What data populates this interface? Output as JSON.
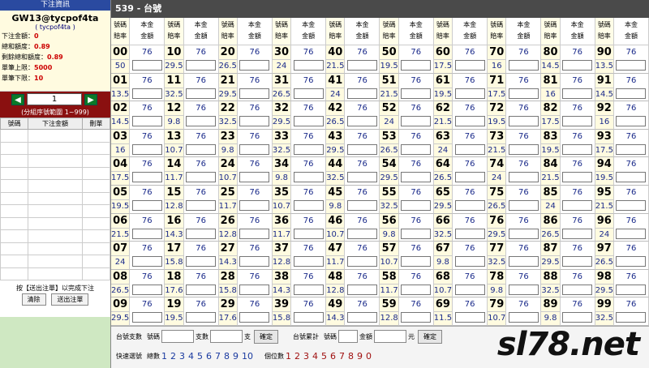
{
  "sidebar": {
    "header": "下注資訊",
    "account": "GW13@tycpof4ta",
    "account_sub": "( tycpof4ta )",
    "rows": [
      {
        "label": "下注金額：",
        "value": "0"
      },
      {
        "label": "總和額度：",
        "value": "0.89"
      },
      {
        "label": "剩餘總和額度：",
        "value": "0.89"
      },
      {
        "label": "單筆上限：",
        "value": "5000"
      },
      {
        "label": "單筆下限：",
        "value": "10"
      }
    ],
    "page_value": "1",
    "range_text": "(分組序號範圍 1~999)",
    "columns": [
      "號碼",
      "下注金額",
      "刪單"
    ],
    "note": "按【送出注單】以完成下注",
    "clear_label": "清除",
    "submit_label": "送出注單"
  },
  "main": {
    "title": "539 - 台號",
    "header_top": [
      "號碼",
      "本金"
    ],
    "header_bottom": [
      "賠率",
      "金額"
    ],
    "odds_value": "76",
    "cells": [
      [
        [
          "00",
          "50"
        ],
        [
          "10",
          "29.5"
        ],
        [
          "20",
          "26.5"
        ],
        [
          "30",
          "24"
        ],
        [
          "40",
          "21.5"
        ],
        [
          "50",
          "19.5"
        ],
        [
          "60",
          "17.5"
        ],
        [
          "70",
          "16"
        ],
        [
          "80",
          "14.5"
        ],
        [
          "90",
          "13.5"
        ]
      ],
      [
        [
          "01",
          "13.5"
        ],
        [
          "11",
          "32.5"
        ],
        [
          "21",
          "29.5"
        ],
        [
          "31",
          "26.5"
        ],
        [
          "41",
          "24"
        ],
        [
          "51",
          "21.5"
        ],
        [
          "61",
          "19.5"
        ],
        [
          "71",
          "17.5"
        ],
        [
          "81",
          "16"
        ],
        [
          "91",
          "14.5"
        ]
      ],
      [
        [
          "02",
          "14.5"
        ],
        [
          "12",
          "9.8"
        ],
        [
          "22",
          "32.5"
        ],
        [
          "32",
          "29.5"
        ],
        [
          "42",
          "26.5"
        ],
        [
          "52",
          "24"
        ],
        [
          "62",
          "21.5"
        ],
        [
          "72",
          "19.5"
        ],
        [
          "82",
          "17.5"
        ],
        [
          "92",
          "16"
        ]
      ],
      [
        [
          "03",
          "16"
        ],
        [
          "13",
          "10.7"
        ],
        [
          "23",
          "9.8"
        ],
        [
          "33",
          "32.5"
        ],
        [
          "43",
          "29.5"
        ],
        [
          "53",
          "26.5"
        ],
        [
          "63",
          "24"
        ],
        [
          "73",
          "21.5"
        ],
        [
          "83",
          "19.5"
        ],
        [
          "93",
          "17.5"
        ]
      ],
      [
        [
          "04",
          "17.5"
        ],
        [
          "14",
          "11.7"
        ],
        [
          "24",
          "10.7"
        ],
        [
          "34",
          "9.8"
        ],
        [
          "44",
          "32.5"
        ],
        [
          "54",
          "29.5"
        ],
        [
          "64",
          "26.5"
        ],
        [
          "74",
          "24"
        ],
        [
          "84",
          "21.5"
        ],
        [
          "94",
          "19.5"
        ]
      ],
      [
        [
          "05",
          "19.5"
        ],
        [
          "15",
          "12.8"
        ],
        [
          "25",
          "11.7"
        ],
        [
          "35",
          "10.7"
        ],
        [
          "45",
          "9.8"
        ],
        [
          "55",
          "32.5"
        ],
        [
          "65",
          "29.5"
        ],
        [
          "75",
          "26.5"
        ],
        [
          "85",
          "24"
        ],
        [
          "95",
          "21.5"
        ]
      ],
      [
        [
          "06",
          "21.5"
        ],
        [
          "16",
          "14.3"
        ],
        [
          "26",
          "12.8"
        ],
        [
          "36",
          "11.7"
        ],
        [
          "46",
          "10.7"
        ],
        [
          "56",
          "9.8"
        ],
        [
          "66",
          "32.5"
        ],
        [
          "76",
          "29.5"
        ],
        [
          "86",
          "26.5"
        ],
        [
          "96",
          "24"
        ]
      ],
      [
        [
          "07",
          "24"
        ],
        [
          "17",
          "15.8"
        ],
        [
          "27",
          "14.3"
        ],
        [
          "37",
          "12.8"
        ],
        [
          "47",
          "11.7"
        ],
        [
          "57",
          "10.7"
        ],
        [
          "67",
          "9.8"
        ],
        [
          "77",
          "32.5"
        ],
        [
          "87",
          "29.5"
        ],
        [
          "97",
          "26.5"
        ]
      ],
      [
        [
          "08",
          "26.5"
        ],
        [
          "18",
          "17.6"
        ],
        [
          "28",
          "15.8"
        ],
        [
          "38",
          "14.3"
        ],
        [
          "48",
          "12.8"
        ],
        [
          "58",
          "11.7"
        ],
        [
          "68",
          "10.7"
        ],
        [
          "78",
          "9.8"
        ],
        [
          "88",
          "32.5"
        ],
        [
          "98",
          "29.5"
        ]
      ],
      [
        [
          "09",
          "29.5"
        ],
        [
          "19",
          "19.5"
        ],
        [
          "29",
          "17.6"
        ],
        [
          "39",
          "15.8"
        ],
        [
          "49",
          "14.3"
        ],
        [
          "59",
          "12.8"
        ],
        [
          "69",
          "11.5"
        ],
        [
          "79",
          "10.7"
        ],
        [
          "89",
          "9.8"
        ],
        [
          "99",
          "32.5"
        ]
      ]
    ]
  },
  "bottom": {
    "row1_label": "台號支數",
    "num_label": "號碼",
    "count_label": "支數",
    "unit_zhi": "支",
    "confirm": "確定",
    "row1b_label": "台號累計",
    "amount_label": "金額",
    "unit_yuan": "元",
    "row2_label": "快速選號",
    "total_label": "總數",
    "total_nums": [
      "1",
      "2",
      "3",
      "4",
      "5",
      "6",
      "7",
      "8",
      "9",
      "10"
    ],
    "digit_label": "個位數",
    "digit_nums": [
      "1",
      "2",
      "3",
      "4",
      "5",
      "6",
      "7",
      "8",
      "9",
      "0"
    ]
  },
  "watermark": "sl78.net"
}
